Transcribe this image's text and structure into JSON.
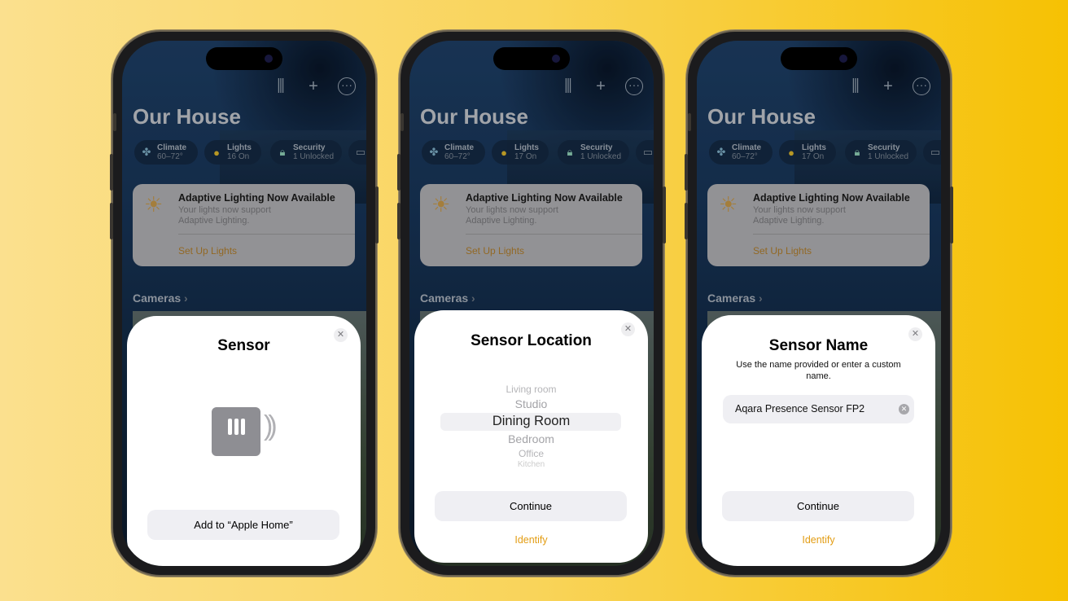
{
  "colors": {
    "background_left": "#fbe08e",
    "background_right": "#f6c103",
    "accent": "#e39d14"
  },
  "home": {
    "title": "Our House",
    "icons": [
      "waveform-icon",
      "plus-icon",
      "more-icon"
    ],
    "chips": [
      {
        "icon": "fan-icon",
        "title": "Climate",
        "sub": "60–72°"
      },
      {
        "icon": "lightbulb-icon",
        "title": "Lights",
        "sub_by_phone": [
          "16 On",
          "17 On",
          "17 On"
        ]
      },
      {
        "icon": "lock-icon",
        "title": "Security",
        "sub": "1 Unlocked"
      }
    ],
    "card": {
      "title": "Adaptive Lighting Now Available",
      "desc": "Your lights now support Adaptive Lighting.",
      "link": "Set Up Lights"
    },
    "cameras": "Cameras"
  },
  "phones": [
    {
      "lights_sub": "16 On",
      "sheet": {
        "title": "Sensor",
        "button": "Add to “Apple Home”"
      }
    },
    {
      "lights_sub": "17 On",
      "sheet": {
        "title": "Sensor Location",
        "options": [
          "Living room",
          "Studio",
          "Dining Room",
          "Bedroom",
          "Office",
          "Kitchen"
        ],
        "selected": "Dining Room",
        "button": "Continue",
        "link": "Identify"
      }
    },
    {
      "lights_sub": "17 On",
      "sheet": {
        "title": "Sensor Name",
        "subtitle": "Use the name provided or enter a custom name.",
        "input_value": "Aqara Presence Sensor FP2",
        "button": "Continue",
        "link": "Identify"
      }
    }
  ]
}
